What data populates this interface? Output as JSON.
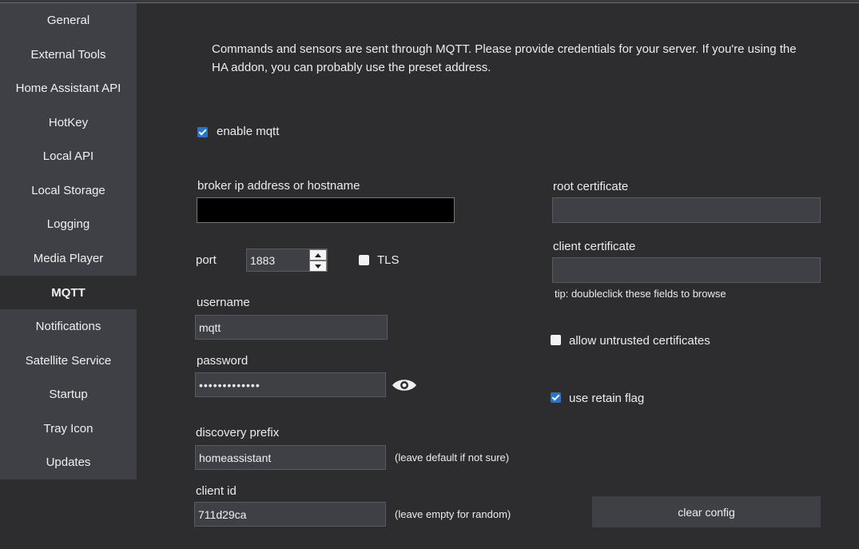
{
  "sidebar": {
    "items": [
      {
        "label": "General"
      },
      {
        "label": "External Tools"
      },
      {
        "label": "Home Assistant API"
      },
      {
        "label": "HotKey"
      },
      {
        "label": "Local API"
      },
      {
        "label": "Local Storage"
      },
      {
        "label": "Logging"
      },
      {
        "label": "Media Player"
      },
      {
        "label": "MQTT",
        "active": true
      },
      {
        "label": "Notifications"
      },
      {
        "label": "Satellite Service"
      },
      {
        "label": "Startup"
      },
      {
        "label": "Tray Icon"
      },
      {
        "label": "Updates"
      }
    ]
  },
  "main": {
    "description": "Commands and sensors are sent through MQTT. Please provide credentials for your server. If you're using the HA addon, you can probably use the preset address.",
    "enable_mqtt": {
      "label": "enable mqtt",
      "checked": true
    },
    "broker": {
      "label": "broker ip address or hostname",
      "value": ""
    },
    "port": {
      "label": "port",
      "value": "1883"
    },
    "tls": {
      "label": "TLS",
      "checked": false
    },
    "username": {
      "label": "username",
      "value": "mqtt"
    },
    "password": {
      "label": "password",
      "value": "•••••••••••••",
      "toggle_icon": "eye-icon"
    },
    "discovery_prefix": {
      "label": "discovery prefix",
      "value": "homeassistant",
      "hint": "(leave default if not sure)"
    },
    "client_id": {
      "label": "client id",
      "value": "711d29ca",
      "hint": "(leave empty for random)"
    },
    "root_certificate": {
      "label": "root certificate",
      "value": ""
    },
    "client_certificate": {
      "label": "client certificate",
      "value": ""
    },
    "tip": "tip: doubleclick these fields to browse",
    "allow_untrusted": {
      "label": "allow untrusted certificates",
      "checked": false
    },
    "retain_flag": {
      "label": "use retain flag",
      "checked": true
    },
    "clear_button": "clear config"
  },
  "colors": {
    "background": "#2d2d30",
    "sidebar": "#3f3f46",
    "accent": "#1e77d3"
  }
}
